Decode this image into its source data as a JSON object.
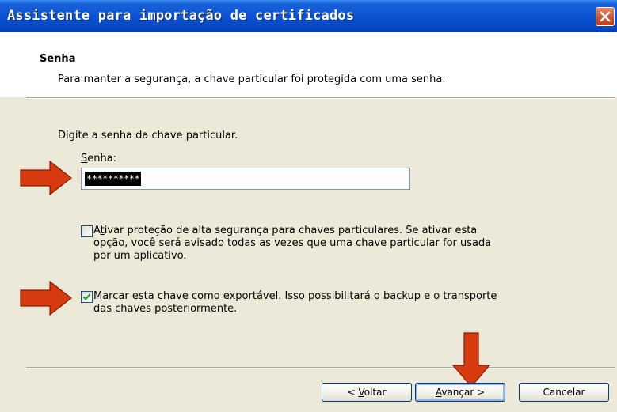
{
  "window": {
    "title": "Assistente para importação de certificados"
  },
  "header": {
    "title": "Senha",
    "description": "Para manter a segurança, a chave particular foi protegida com uma senha."
  },
  "body": {
    "prompt": "Digite a senha da chave particular.",
    "password_label": {
      "mnemonic": "S",
      "rest": "enha:"
    },
    "password_value": "**********",
    "strong_protection": {
      "checked": false,
      "pre": "A",
      "mnemonic": "t",
      "line1_rest": "ivar proteção de alta segurança para chaves particulares. Se ativar esta",
      "line2": "opção, você será avisado todas as vezes que uma chave particular for usada",
      "line3": "por um aplicativo."
    },
    "exportable": {
      "checked": true,
      "mnemonic": "M",
      "line1_rest": "arcar esta chave como exportável. Isso possibilitará o backup e o transporte",
      "line2": "das chaves posteriormente."
    }
  },
  "buttons": {
    "back": {
      "pre": "< ",
      "mnemonic": "V",
      "rest": "oltar"
    },
    "next": {
      "mnemonic": "A",
      "rest": "vançar >"
    },
    "cancel": {
      "label": "Cancelar"
    }
  },
  "colors": {
    "titlebar": "#0A52D3",
    "dialog_bg": "#ECE9D8",
    "annotation_arrow": "#D63A0E",
    "checkmark": "#21A121"
  }
}
